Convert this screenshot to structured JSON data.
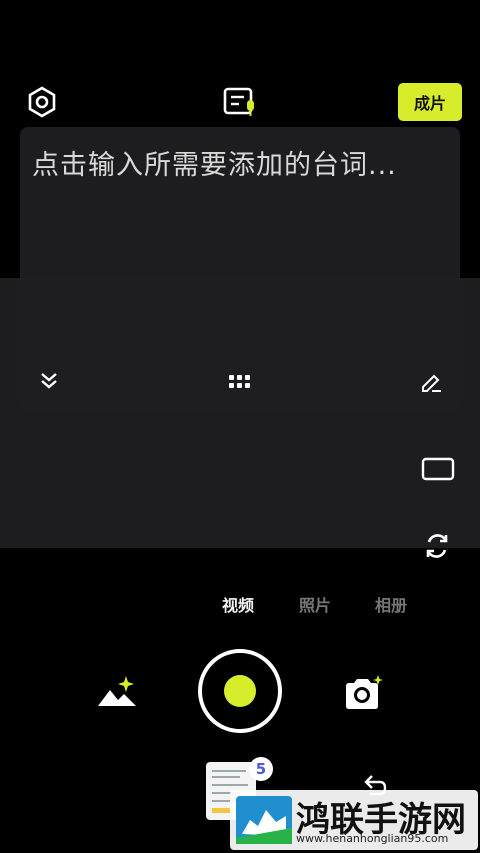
{
  "header": {
    "settings_icon": "hexagon-settings-icon",
    "script_icon": "teleprompter-icon",
    "finish_label": "成片",
    "accent": "#d7ec2a"
  },
  "script_panel": {
    "placeholder": "点击输入所需要添加的台词..."
  },
  "panel_tools": {
    "collapse_icon": "chevron-double-down-icon",
    "grid_icon": "six-dot-grid-icon",
    "edit_icon": "pencil-icon"
  },
  "side_tools": {
    "ratio_icon": "aspect-ratio-icon",
    "switch_icon": "camera-switch-icon"
  },
  "modes": {
    "items": [
      "视频",
      "照片",
      "相册"
    ],
    "selected": "视频"
  },
  "capture": {
    "left_icon": "ai-image-icon",
    "right_icon": "camera-add-icon"
  },
  "drafts": {
    "count": "5"
  },
  "watermark": {
    "name": "鸿联手游网",
    "url": "www.henanhonglian95.com"
  }
}
